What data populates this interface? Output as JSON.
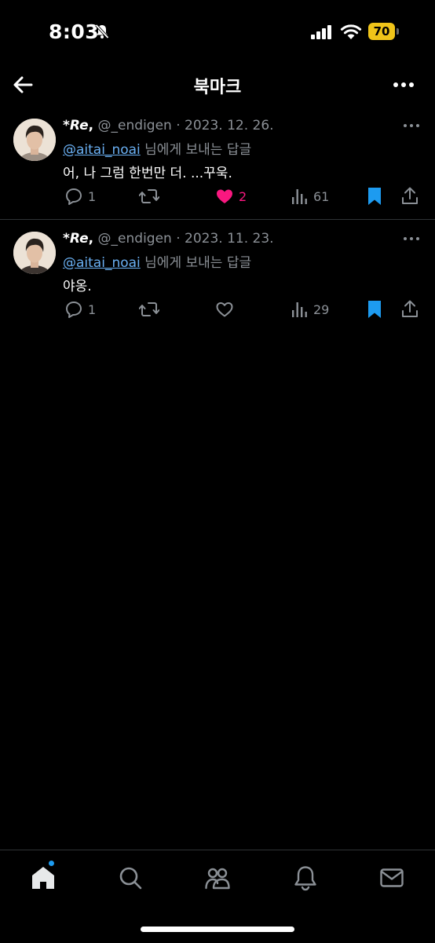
{
  "status_bar": {
    "time": "8:03",
    "battery": "70"
  },
  "header": {
    "title": "북마크"
  },
  "tweets": [
    {
      "name": "*Re",
      "handle": "@_endigen",
      "date": "· 2023. 12. 26.",
      "reply_to_handle": "@aitai_noai",
      "reply_to_suffix": "님에게 보내는 답글",
      "text": "어, 나 그럼 한번만 더. ...꾸욱.",
      "replies": "1",
      "likes": "2",
      "views": "61",
      "liked": true
    },
    {
      "name": "*Re",
      "handle": "@_endigen",
      "date": "· 2023. 11. 23.",
      "reply_to_handle": "@aitai_noai",
      "reply_to_suffix": "님에게 보내는 답글",
      "text": "야옹.",
      "replies": "1",
      "likes": "",
      "views": "29",
      "liked": false
    }
  ],
  "tabs": [
    {
      "icon": "home-icon"
    },
    {
      "icon": "search-icon"
    },
    {
      "icon": "communities-icon"
    },
    {
      "icon": "notifications-icon"
    },
    {
      "icon": "messages-icon"
    }
  ],
  "colors": {
    "accent": "#1d9bf0",
    "like": "#f91880",
    "mention": "#6ab0f3",
    "battery": "#f0c419"
  }
}
